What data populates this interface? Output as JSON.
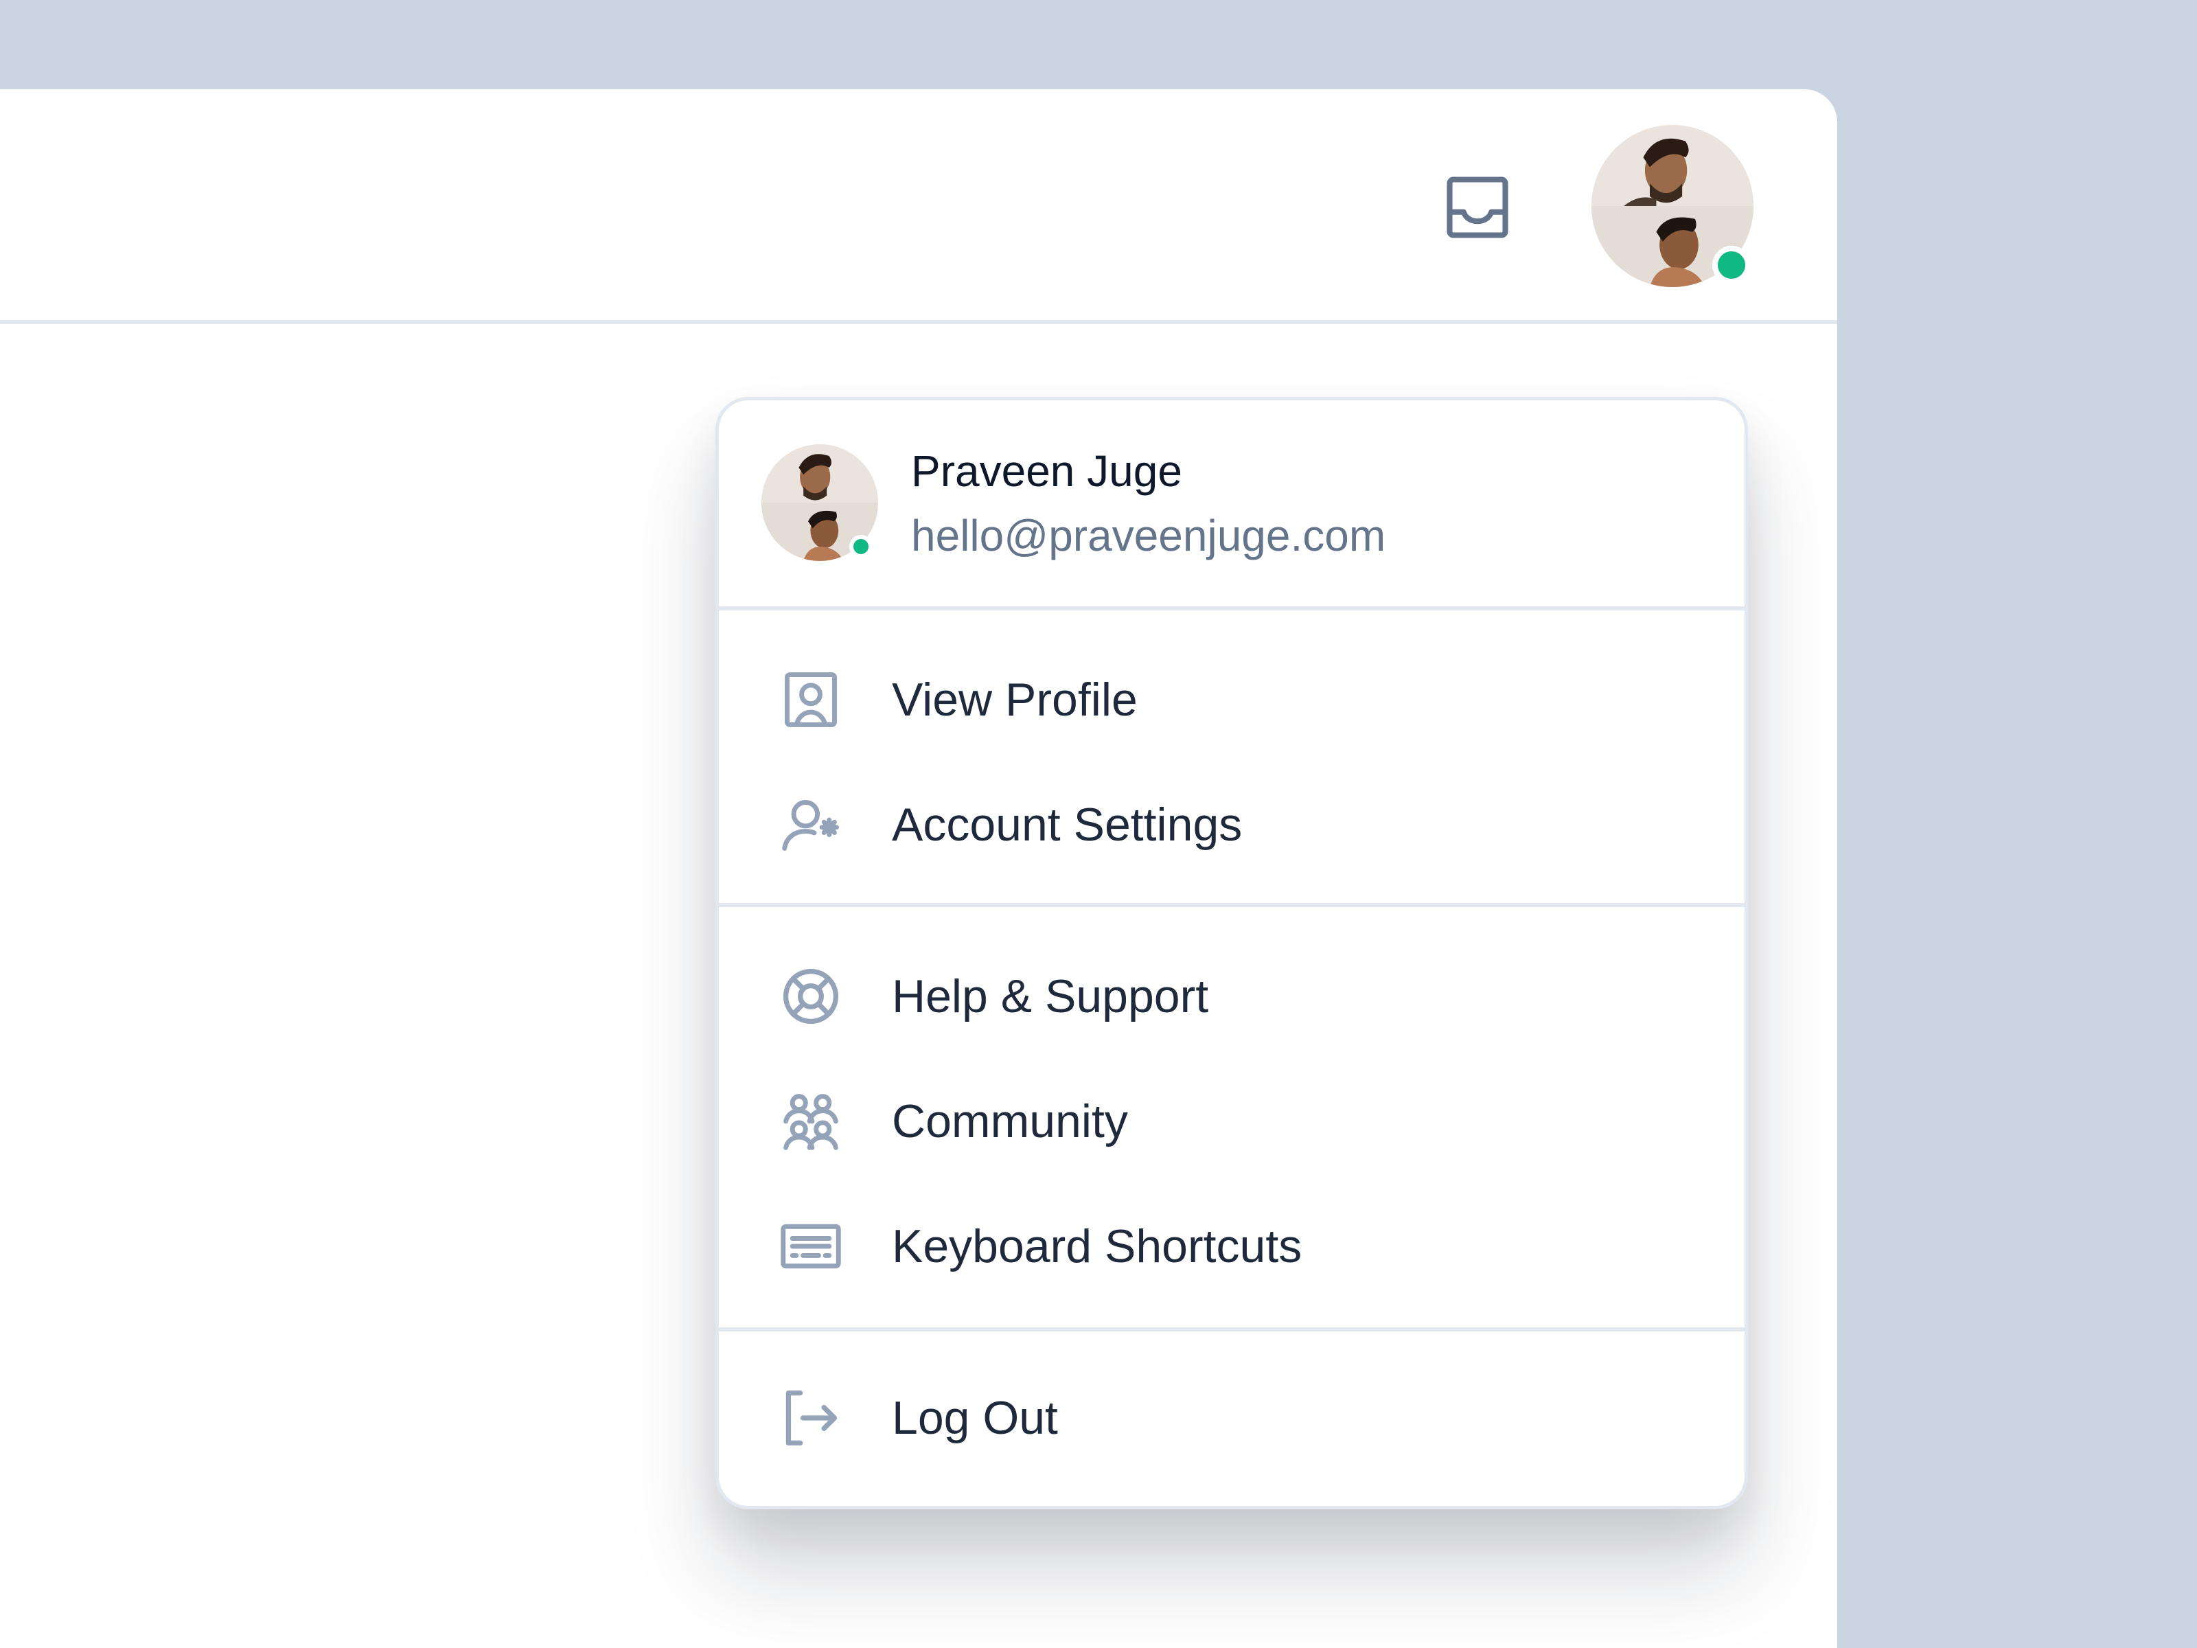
{
  "header": {
    "inbox_icon": "inbox-tray-icon",
    "avatar_status": "online",
    "status_color": "#10b981"
  },
  "menu": {
    "user": {
      "name": "Praveen Juge",
      "email": "hello@praveenjuge.com",
      "status": "online"
    },
    "sections": [
      {
        "items": [
          {
            "label": "View Profile",
            "icon": "user-square-icon"
          },
          {
            "label": "Account Settings",
            "icon": "user-gear-icon"
          }
        ]
      },
      {
        "items": [
          {
            "label": "Help & Support",
            "icon": "lifebuoy-icon"
          },
          {
            "label": "Community",
            "icon": "users-group-icon"
          },
          {
            "label": "Keyboard Shortcuts",
            "icon": "keyboard-icon"
          }
        ]
      },
      {
        "items": [
          {
            "label": "Log Out",
            "icon": "logout-icon"
          }
        ]
      }
    ]
  },
  "colors": {
    "background": "#cbd5e1",
    "surface": "#ffffff",
    "border": "#e2e8f0",
    "text_primary": "#1e293b",
    "text_secondary": "#64748b",
    "icon": "#94a3b8",
    "online": "#10b981"
  }
}
